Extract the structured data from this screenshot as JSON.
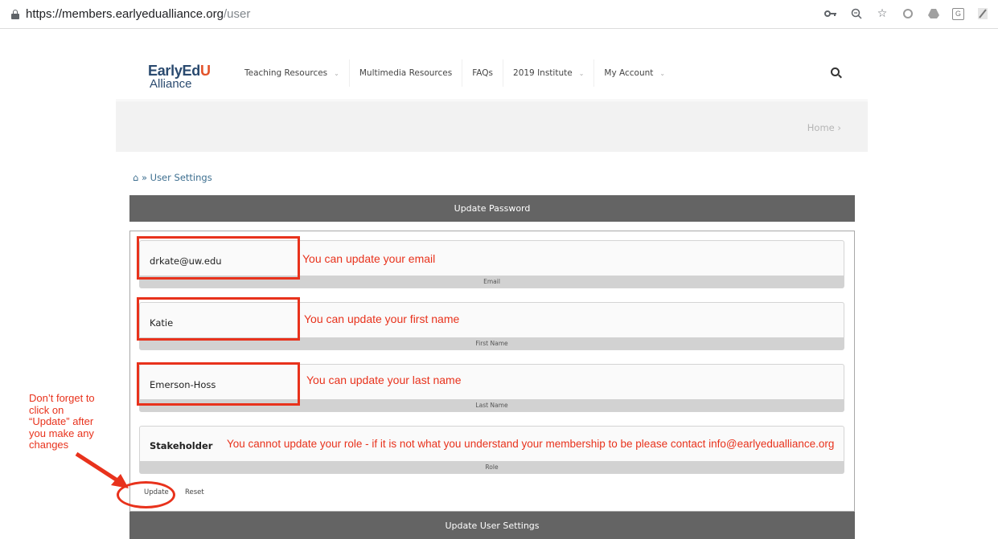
{
  "browser": {
    "url_host": "https://members.earlyedualliance.org",
    "url_path": "/user",
    "icons": [
      "key-icon",
      "zoom-icon",
      "star-icon",
      "circle-ext-icon",
      "drive-ext-icon",
      "g-ext-icon",
      "edit-ext-icon"
    ]
  },
  "site": {
    "logo_line1": "EarlyEd",
    "logo_line1_accent": "U",
    "logo_line2": "Alliance",
    "nav": [
      {
        "label": "Teaching Resources",
        "caret": "⌄"
      },
      {
        "label": "Multimedia Resources"
      },
      {
        "label": "FAQs"
      },
      {
        "label": "2019 Institute",
        "caret": "⌄"
      },
      {
        "label": "My Account",
        "caret": "⌄"
      }
    ],
    "band_home": "Home  ›"
  },
  "page": {
    "breadcrumb": "⌂ » User Settings",
    "update_password": "Update Password",
    "update_user_settings": "Update User Settings"
  },
  "form": {
    "email": {
      "value": "drkate@uw.edu",
      "label": "Email"
    },
    "first_name": {
      "value": "Katie",
      "label": "First Name"
    },
    "last_name": {
      "value": "Emerson-Hoss",
      "label": "Last Name"
    },
    "role": {
      "value": "Stakeholder",
      "label": "Role"
    },
    "update_label": "Update",
    "reset_label": "Reset"
  },
  "annotations": {
    "email": "You can update your email",
    "first_name": "You can update your first name",
    "last_name": "You can update your last name",
    "role": "You cannot update your role - if it is not what you understand your membership to be please contact info@earlyedualliance.org",
    "side_note": "Don’t forget to click on “Update” after you make any changes",
    "annotation_color": "#e8321c"
  }
}
